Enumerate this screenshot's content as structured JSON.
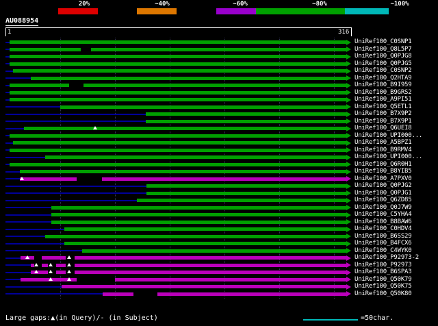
{
  "title": "AU088954",
  "scale_key": {
    "items": [
      {
        "label": "20%",
        "color": "#dd0000",
        "seg_x": 85,
        "seg_w": 58,
        "label_x": 123
      },
      {
        "label": "~40%",
        "color": "#dd7700",
        "seg_x": 200,
        "seg_w": 58,
        "label_x": 237
      },
      {
        "label": "~60%",
        "color": "#9900cc",
        "seg_x": 316,
        "seg_w": 58,
        "label_x": 351
      },
      {
        "label": "~80%",
        "color": "#00a000",
        "seg_x": 374,
        "seg_w": 130,
        "label_x": 467
      },
      {
        "label": "~100%",
        "color": "#00b8b8",
        "seg_x": 504,
        "seg_w": 64,
        "label_x": 584
      }
    ]
  },
  "ruler": {
    "start_label": "1",
    "end_label": "316"
  },
  "chart_data": {
    "type": "bar",
    "orientation": "horizontal",
    "x_range": [
      1,
      316
    ],
    "bars_end": 316,
    "grid_interval": 50,
    "colors": {
      "green": "#00a000",
      "magenta": "#bb00bb",
      "navy": "#000099",
      "gap_black": "#000000",
      "triangle": "#ffffff"
    },
    "rows": [
      {
        "label": "UniRef100_C0SNP1",
        "color": "green",
        "start": 5,
        "gaps": [],
        "tris": []
      },
      {
        "label": "UniRef100_Q8L5P7",
        "color": "green",
        "start": 5,
        "gaps": [
          [
            70,
            79
          ]
        ],
        "tris": []
      },
      {
        "label": "UniRef100_Q0PJG8",
        "color": "green",
        "start": 5,
        "gaps": [],
        "tris": []
      },
      {
        "label": "UniRef100_Q0PJG5",
        "color": "green",
        "start": 5,
        "gaps": [],
        "tris": []
      },
      {
        "label": "UniRef100_C0SNP2",
        "color": "green",
        "start": 8,
        "gaps": [],
        "tris": []
      },
      {
        "label": "UniRef100_Q2HTA9",
        "color": "green",
        "start": 24,
        "gaps": [],
        "tris": []
      },
      {
        "label": "UniRef100_B9I959",
        "color": "green",
        "start": 5,
        "gaps": [
          [
            59,
            72
          ]
        ],
        "tris": []
      },
      {
        "label": "UniRef100_B9GRS2",
        "color": "green",
        "start": 5,
        "gaps": [],
        "tris": []
      },
      {
        "label": "UniRef100_A9PI51",
        "color": "green",
        "start": 5,
        "gaps": [],
        "tris": []
      },
      {
        "label": "UniRef100_Q5ETL1",
        "color": "green",
        "start": 51,
        "gaps": [],
        "tris": []
      },
      {
        "label": "UniRef100_B7X9P2",
        "color": "green",
        "start": 129,
        "gaps": [],
        "tris": []
      },
      {
        "label": "UniRef100_B7X9P1",
        "color": "green",
        "start": 129,
        "gaps": [],
        "tris": []
      },
      {
        "label": "UniRef100_Q6UEI8",
        "color": "green",
        "start": 18,
        "gaps": [],
        "tris": [
          83
        ]
      },
      {
        "label": "UniRef100_UPI000...",
        "color": "green",
        "start": 5,
        "gaps": [],
        "tris": []
      },
      {
        "label": "UniRef100_A5BPZ1",
        "color": "green",
        "start": 8,
        "gaps": [],
        "tris": []
      },
      {
        "label": "UniRef100_B9RMV4",
        "color": "green",
        "start": 5,
        "gaps": [],
        "tris": []
      },
      {
        "label": "UniRef100_UPI000...",
        "color": "green",
        "start": 37,
        "gaps": [],
        "tris": []
      },
      {
        "label": "UniRef100_Q6R0H1",
        "color": "green",
        "start": 5,
        "gaps": [],
        "tris": []
      },
      {
        "label": "UniRef100_B8YIB5",
        "color": "green",
        "start": 14,
        "gaps": [],
        "tris": []
      },
      {
        "label": "UniRef100_A7PXV0",
        "color": "magenta",
        "start": 14,
        "gaps": [
          [
            66,
            89
          ]
        ],
        "tris": [
          16
        ]
      },
      {
        "label": "UniRef100_Q0PJG2",
        "color": "green",
        "start": 130,
        "gaps": [],
        "tris": []
      },
      {
        "label": "UniRef100_Q0PJG1",
        "color": "green",
        "start": 130,
        "gaps": [],
        "tris": []
      },
      {
        "label": "UniRef100_Q6ZD85",
        "color": "green",
        "start": 121,
        "gaps": [],
        "tris": []
      },
      {
        "label": "UniRef100_Q0J7W9",
        "color": "green",
        "start": 43,
        "gaps": [],
        "tris": []
      },
      {
        "label": "UniRef100_C5YHA4",
        "color": "green",
        "start": 43,
        "gaps": [],
        "tris": []
      },
      {
        "label": "UniRef100_B8BAW6",
        "color": "green",
        "start": 43,
        "gaps": [],
        "tris": []
      },
      {
        "label": "UniRef100_C0HDV4",
        "color": "green",
        "start": 55,
        "gaps": [],
        "tris": []
      },
      {
        "label": "UniRef100_B6SS29",
        "color": "green",
        "start": 37,
        "gaps": [],
        "tris": []
      },
      {
        "label": "UniRef100_B4FCX6",
        "color": "green",
        "start": 55,
        "gaps": [],
        "tris": []
      },
      {
        "label": "UniRef100_C4WYK0",
        "color": "green",
        "start": 71,
        "gaps": [],
        "tris": []
      },
      {
        "label": "UniRef100_P92973-2",
        "color": "magenta",
        "start": 15,
        "gaps": [
          [
            27,
            34
          ],
          [
            56,
            64
          ]
        ],
        "tris": [
          21,
          59
        ]
      },
      {
        "label": "UniRef100_P92973",
        "color": "magenta",
        "start": 24,
        "gaps": [
          [
            27,
            34
          ],
          [
            40,
            47
          ],
          [
            56,
            64
          ]
        ],
        "tris": [
          29,
          42,
          59
        ]
      },
      {
        "label": "UniRef100_B6SPA3",
        "color": "magenta",
        "start": 24,
        "gaps": [
          [
            40,
            47
          ],
          [
            56,
            64
          ]
        ],
        "tris": [
          29,
          42,
          59
        ]
      },
      {
        "label": "UniRef100_Q50K79",
        "color": "magenta",
        "start": 15,
        "gaps": [
          [
            66,
            101
          ]
        ],
        "tris": [
          42,
          59
        ]
      },
      {
        "label": "UniRef100_Q50K75",
        "color": "magenta",
        "start": 52,
        "gaps": [],
        "tris": []
      },
      {
        "label": "UniRef100_Q50K80",
        "color": "magenta",
        "start": 90,
        "gaps": [
          [
            118,
            140
          ]
        ],
        "tris": []
      }
    ]
  },
  "footer": {
    "gaps_legend": "Large gaps:▲(in Query)/- (in Subject)",
    "scale_line_label": "=50char.",
    "scale_line_color": "#00b8b8"
  }
}
